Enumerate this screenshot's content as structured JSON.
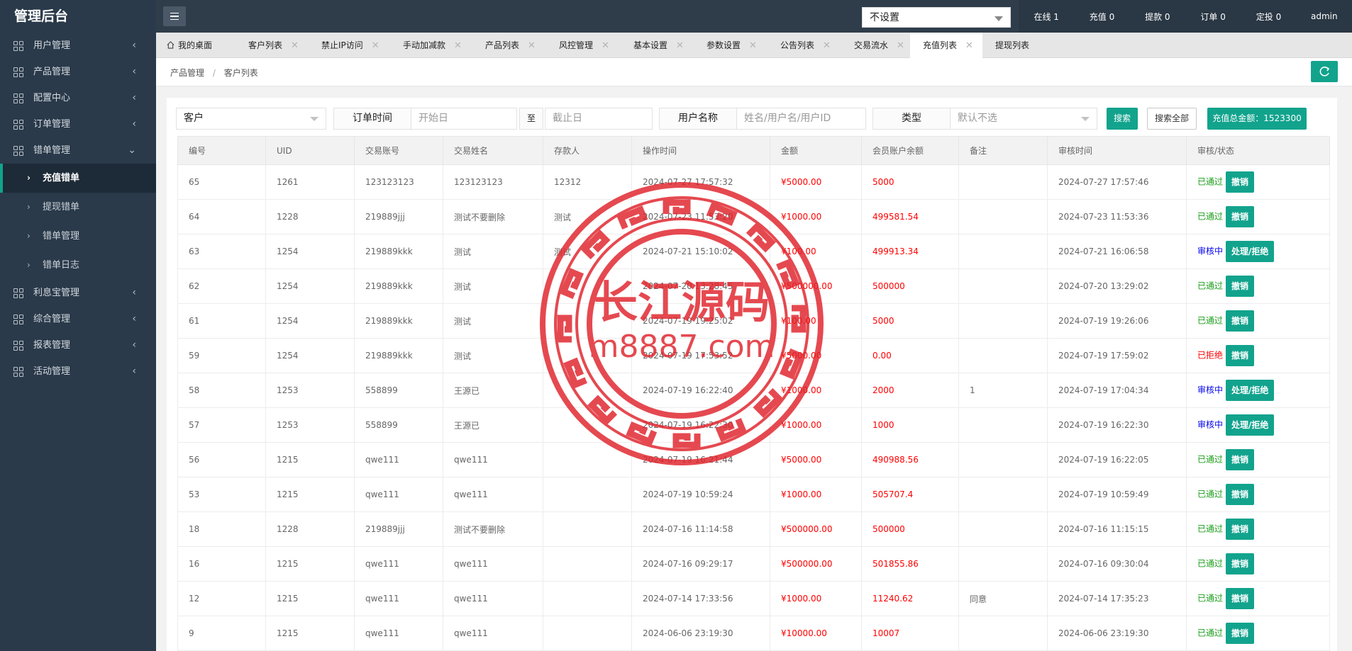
{
  "app": {
    "title": "管理后台"
  },
  "sidebar": {
    "items": [
      {
        "label": "用户管理",
        "chevron": "‹"
      },
      {
        "label": "产品管理",
        "chevron": "‹"
      },
      {
        "label": "配置中心",
        "chevron": "‹"
      },
      {
        "label": "订单管理",
        "chevron": "‹"
      },
      {
        "label": "错单管理",
        "chevron": "⌄"
      }
    ],
    "sub_items": [
      {
        "label": "充值错单",
        "active": true
      },
      {
        "label": "提现错单"
      },
      {
        "label": "错单管理"
      },
      {
        "label": "错单日志"
      }
    ],
    "items_after": [
      {
        "label": "利息宝管理",
        "chevron": "‹"
      },
      {
        "label": "综合管理",
        "chevron": "‹"
      },
      {
        "label": "报表管理",
        "chevron": "‹"
      },
      {
        "label": "活动管理",
        "chevron": "‹"
      }
    ]
  },
  "header": {
    "select_value": "不设置",
    "stats": [
      "在线 1",
      "充值 0",
      "提款 0",
      "订单 0",
      "定投 0",
      "admin"
    ],
    "dropdown_arrow": "▾"
  },
  "tabs": [
    {
      "label": "我的桌面"
    },
    {
      "label": "客户列表",
      "close": "✕"
    },
    {
      "label": "禁止IP访问",
      "close": "✕"
    },
    {
      "label": "手动加减款",
      "close": "✕"
    },
    {
      "label": "产品列表",
      "close": "✕"
    },
    {
      "label": "风控管理",
      "close": "✕"
    },
    {
      "label": "基本设置",
      "close": "✕"
    },
    {
      "label": "参数设置",
      "close": "✕"
    },
    {
      "label": "公告列表",
      "close": "✕"
    },
    {
      "label": "交易流水",
      "close": "✕"
    },
    {
      "label": "充值列表",
      "close": "✕",
      "active": true
    },
    {
      "label": "提现列表",
      "close": "✕"
    }
  ],
  "breadcrumb": {
    "parent": "产品管理",
    "separator": "/",
    "current": "客户列表"
  },
  "search": {
    "type_select": "客户",
    "order_time_label": "订单时间",
    "start_placeholder": "开始日",
    "to_label": "至",
    "end_placeholder": "截止日",
    "username_label": "用户名称",
    "username_placeholder": "姓名/用户名/用户ID",
    "category_label": "类型",
    "category_value": "默认不选",
    "search_button": "搜索",
    "search_all_button": "搜索全部",
    "total_label": "充值总金额：1523300"
  },
  "table": {
    "columns": [
      "编号",
      "UID",
      "交易账号",
      "交易姓名",
      "存款人",
      "操作时间",
      "金额",
      "会员账户余额",
      "备注",
      "审核时间",
      "审核/状态"
    ],
    "rows": [
      {
        "id": "65",
        "uid": "1261",
        "account": "123123123",
        "name": "123123123",
        "depositor": "12312",
        "op_time": "2024-07-27 17:57:32",
        "amount": "¥5000.00",
        "balance": "5000",
        "note": "",
        "review_time": "2024-07-27 17:57:46",
        "status": "已通过",
        "status_type": "pass",
        "action": "撤销"
      },
      {
        "id": "64",
        "uid": "1228",
        "account": "219889jjj",
        "name": "测试不要删除",
        "depositor": "测试",
        "op_time": "2024-07-23 11:53:20",
        "amount": "¥1000.00",
        "balance": "499581.54",
        "note": "",
        "review_time": "2024-07-23 11:53:36",
        "status": "已通过",
        "status_type": "pass",
        "action": "撤销"
      },
      {
        "id": "63",
        "uid": "1254",
        "account": "219889kkk",
        "name": "测试",
        "depositor": "测试",
        "op_time": "2024-07-21 15:10:02",
        "amount": "¥100.00",
        "balance": "499913.34",
        "note": "",
        "review_time": "2024-07-21 16:06:58",
        "status": "审核中",
        "status_type": "pending",
        "action": "处理/拒绝"
      },
      {
        "id": "62",
        "uid": "1254",
        "account": "219889kkk",
        "name": "测试",
        "depositor": "",
        "op_time": "2024-07-20 13:28:45",
        "amount": "¥500000.00",
        "balance": "500000",
        "note": "",
        "review_time": "2024-07-20 13:29:02",
        "status": "已通过",
        "status_type": "pass",
        "action": "撤销"
      },
      {
        "id": "61",
        "uid": "1254",
        "account": "219889kkk",
        "name": "测试",
        "depositor": "",
        "op_time": "2024-07-19 19:25:02",
        "amount": "¥100.00",
        "balance": "5000",
        "note": "",
        "review_time": "2024-07-19 19:26:06",
        "status": "已通过",
        "status_type": "pass",
        "action": "撤销"
      },
      {
        "id": "59",
        "uid": "1254",
        "account": "219889kkk",
        "name": "测试",
        "depositor": "",
        "op_time": "2024-07-19 17:53:52",
        "amount": "¥5000.00",
        "balance": "0.00",
        "note": "",
        "review_time": "2024-07-19 17:59:02",
        "status": "已拒绝",
        "status_type": "reject",
        "action": "撤销"
      },
      {
        "id": "58",
        "uid": "1253",
        "account": "558899",
        "name": "王源已",
        "depositor": "",
        "op_time": "2024-07-19 16:22:40",
        "amount": "¥1000.00",
        "balance": "2000",
        "note": "1",
        "review_time": "2024-07-19 17:04:34",
        "status": "审核中",
        "status_type": "pending",
        "action": "处理/拒绝"
      },
      {
        "id": "57",
        "uid": "1253",
        "account": "558899",
        "name": "王源已",
        "depositor": "",
        "op_time": "2024-07-19 16:22:30",
        "amount": "¥1000.00",
        "balance": "1000",
        "note": "",
        "review_time": "2024-07-19 16:22:30",
        "status": "审核中",
        "status_type": "pending",
        "action": "处理/拒绝"
      },
      {
        "id": "56",
        "uid": "1215",
        "account": "qwe111",
        "name": "qwe111",
        "depositor": "",
        "op_time": "2024-07-19 16:21:44",
        "amount": "¥5000.00",
        "balance": "490988.56",
        "note": "",
        "review_time": "2024-07-19 16:22:05",
        "status": "已通过",
        "status_type": "pass",
        "action": "撤销"
      },
      {
        "id": "53",
        "uid": "1215",
        "account": "qwe111",
        "name": "qwe111",
        "depositor": "",
        "op_time": "2024-07-19 10:59:24",
        "amount": "¥1000.00",
        "balance": "505707.4",
        "note": "",
        "review_time": "2024-07-19 10:59:49",
        "status": "已通过",
        "status_type": "pass",
        "action": "撤销"
      },
      {
        "id": "18",
        "uid": "1228",
        "account": "219889jjj",
        "name": "测试不要删除",
        "depositor": "",
        "op_time": "2024-07-16 11:14:58",
        "amount": "¥500000.00",
        "balance": "500000",
        "note": "",
        "review_time": "2024-07-16 11:15:15",
        "status": "已通过",
        "status_type": "pass",
        "action": "撤销"
      },
      {
        "id": "16",
        "uid": "1215",
        "account": "qwe111",
        "name": "qwe111",
        "depositor": "",
        "op_time": "2024-07-16 09:29:17",
        "amount": "¥500000.00",
        "balance": "501855.86",
        "note": "",
        "review_time": "2024-07-16 09:30:04",
        "status": "已通过",
        "status_type": "pass",
        "action": "撤销"
      },
      {
        "id": "12",
        "uid": "1215",
        "account": "qwe111",
        "name": "qwe111",
        "depositor": "",
        "op_time": "2024-07-14 17:33:56",
        "amount": "¥1000.00",
        "balance": "11240.62",
        "note": "同意",
        "review_time": "2024-07-14 17:35:23",
        "status": "已通过",
        "status_type": "pass",
        "action": "撤销"
      },
      {
        "id": "9",
        "uid": "1215",
        "account": "qwe111",
        "name": "qwe111",
        "depositor": "",
        "op_time": "2024-06-06 23:19:30",
        "amount": "¥10000.00",
        "balance": "10007",
        "note": "",
        "review_time": "2024-06-06 23:19:30",
        "status": "已通过",
        "status_type": "pass",
        "action": "撤销"
      }
    ]
  },
  "watermark": {
    "line1": "长江源码",
    "line2": "m8887.com",
    "color": "#e0222a"
  },
  "colors": {
    "accent": "#12a38d",
    "sidebar": "#2a3a4a",
    "header": "#2f3d4b",
    "money": "#ff0000",
    "pass": "#1a9e1a",
    "pending": "#0000ee",
    "reject": "#ff0000"
  }
}
